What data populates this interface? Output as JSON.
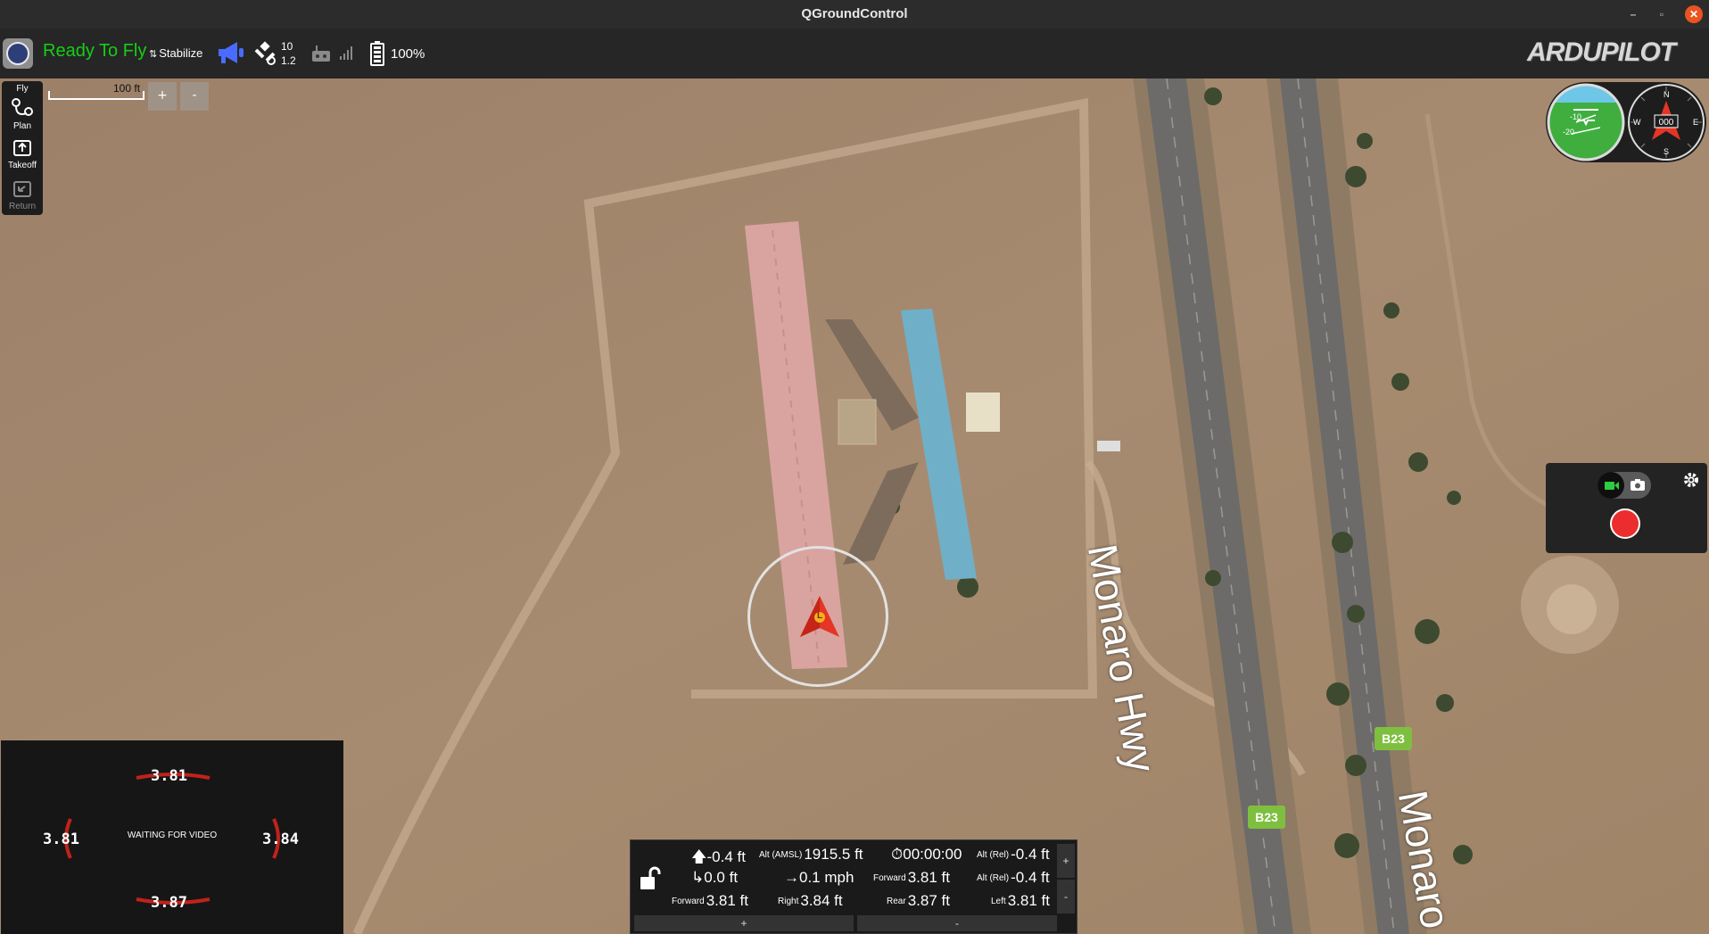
{
  "window": {
    "title": "QGroundControl",
    "controls": {
      "minimize": "–",
      "maximize": "▫",
      "close": "✕"
    }
  },
  "toolbar": {
    "status": "Ready To Fly",
    "status_color": "#15ce15",
    "flight_mode": "Stabilize",
    "gps": {
      "satellites": "10",
      "hdop": "1.2"
    },
    "battery": "100%",
    "brand": "ARDUPILOT"
  },
  "tools": {
    "fly": "Fly",
    "plan": "Plan",
    "takeoff": "Takeoff",
    "return": "Return"
  },
  "map": {
    "scale_label": "100 ft",
    "zoom_in": "+",
    "zoom_out": "-",
    "road_label_1": "Monaro Hwy",
    "road_label_2": "Monaro",
    "route_badge": "B23",
    "vehicle_marker": "L"
  },
  "compass": {
    "heading": "000",
    "n": "N",
    "s": "S",
    "e": "E",
    "w": "W"
  },
  "attitude": {
    "tick_minus10": "-10",
    "tick_minus20": "-20"
  },
  "video": {
    "message": "WAITING FOR VIDEO",
    "front": "3.81",
    "left": "3.81",
    "right": "3.84",
    "rear": "3.87"
  },
  "telemetry": {
    "vertical_speed": "-0.4 ft",
    "alt_amsl_label": "Alt (AMSL)",
    "alt_amsl": "1915.5 ft",
    "flight_time": "00:00:00",
    "alt_rel_label": "Alt (Rel)",
    "alt_rel": "-0.4 ft",
    "distance": "0.0 ft",
    "ground_speed": "0.1 mph",
    "forward_label": "Forward",
    "forward_mid": "3.81 ft",
    "alt_rel_2": "-0.4 ft",
    "forward": "3.81 ft",
    "right_label": "Right",
    "right": "3.84 ft",
    "rear_label": "Rear",
    "rear": "3.87 ft",
    "left_label": "Left",
    "left": "3.81 ft",
    "plus": "+",
    "minus": "-"
  }
}
